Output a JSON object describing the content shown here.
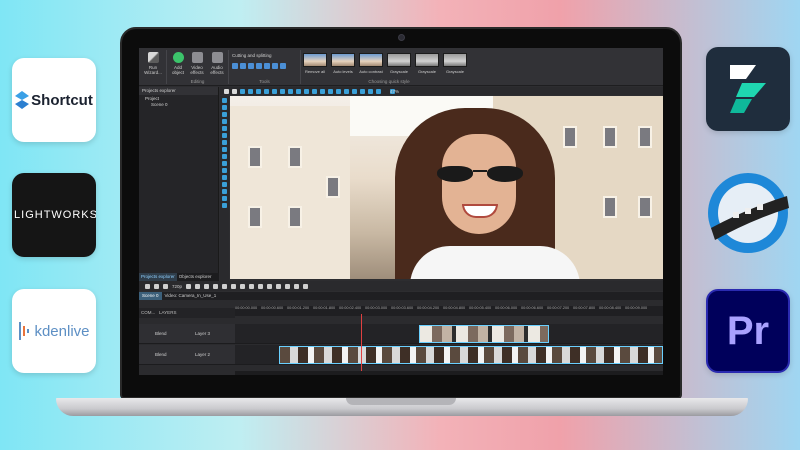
{
  "logos": {
    "left": [
      {
        "name": "Shortcut",
        "text": "Shortcut"
      },
      {
        "name": "Lightworks",
        "text": "LIGHTWORKS"
      },
      {
        "name": "Kdenlive",
        "text": "kdenlive"
      }
    ],
    "right": [
      {
        "name": "Filmora",
        "text": ""
      },
      {
        "name": "OpenShot",
        "text": ""
      },
      {
        "name": "Premiere Pro",
        "text": "Pr"
      }
    ]
  },
  "app": {
    "ribbon": {
      "run_wizard": "Run Wizard...",
      "add_object": "Add object",
      "video_effects": "Video effects",
      "audio_effects": "Audio effects",
      "editing_label": "Editing",
      "tools_title": "Cutting and splitting",
      "tools_label": "Tools",
      "quick_style_label": "Choosing quick style",
      "styles": [
        "Remove all",
        "Auto levels",
        "Auto contrast",
        "Grayscale",
        "Grayscale",
        "Grayscale"
      ]
    },
    "projects_explorer": {
      "title": "Projects explorer",
      "project": "Project",
      "scene": "Scene 0",
      "tabs": [
        "Projects explorer",
        "Objects explorer"
      ]
    },
    "preview_toolbar": {
      "zoom": "47%"
    },
    "playbar": {
      "resolution": "720p"
    },
    "scene_tabs": [
      "Scene 0",
      "Video: Camera_In_Use_1"
    ],
    "timeline": {
      "header_com": "COM...",
      "header_layers": "LAYERS",
      "ruler": [
        "00:00:00.000",
        "00:00:00.600",
        "00:00:01.200",
        "00:00:01.800",
        "00:00:02.400",
        "00:00:03.000",
        "00:00:03.600",
        "00:00:04.200",
        "00:00:04.800",
        "00:00:05.400",
        "00:00:06.000",
        "00:00:06.600",
        "00:00:07.200",
        "00:00:07.800",
        "00:00:08.400",
        "00:00:09.000"
      ],
      "tracks": [
        {
          "blend": "Blend",
          "name": "Layer 3"
        },
        {
          "blend": "Blend",
          "name": "Layer 2"
        }
      ]
    }
  },
  "colors": {
    "accent": "#3aa0d8",
    "playhead": "#e04040",
    "clip_border": "#6ad0ff"
  }
}
